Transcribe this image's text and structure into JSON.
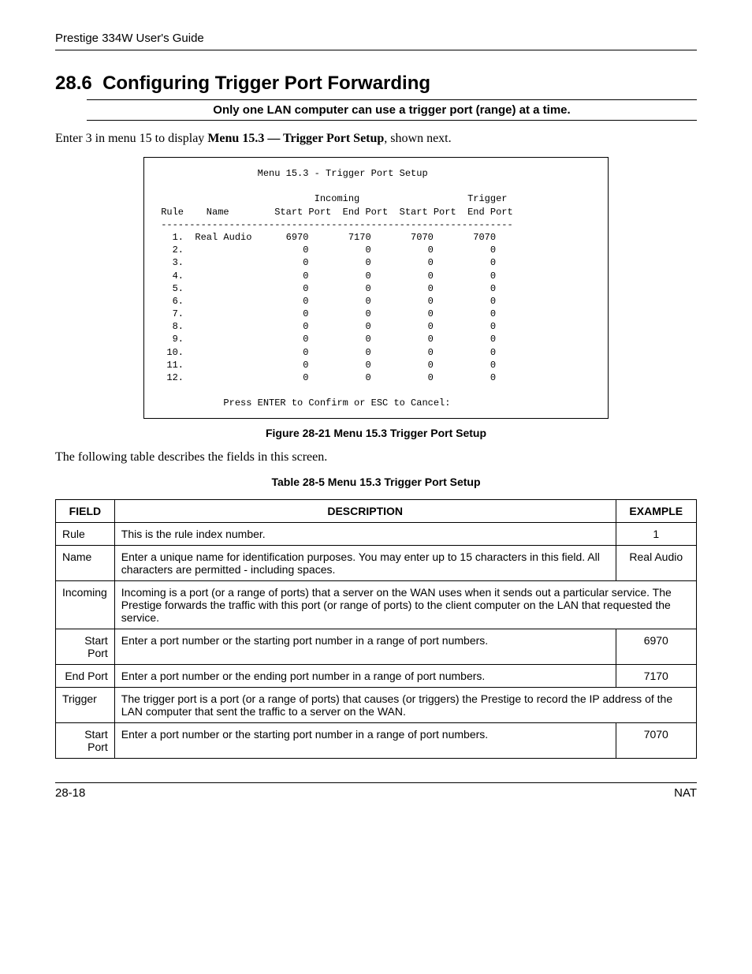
{
  "header": {
    "title": "Prestige 334W User's Guide"
  },
  "section": {
    "number": "28.6",
    "title": "Configuring Trigger Port Forwarding"
  },
  "note": "Only one LAN computer can use a trigger port (range) at a time.",
  "intro_prefix": "Enter 3 in menu 15 to display ",
  "intro_bold": "Menu 15.3 — Trigger Port Setup",
  "intro_suffix": ", shown next.",
  "figure": {
    "title": "Menu 15.3 - Trigger Port Setup",
    "group1": "Incoming",
    "group2": "Trigger",
    "col_rule": "Rule",
    "col_name": "Name",
    "col_start": "Start Port",
    "col_end": "End Port",
    "rows": [
      {
        "n": "1.",
        "name": "Real Audio",
        "is": "6970",
        "ie": "7170",
        "ts": "7070",
        "te": "7070"
      },
      {
        "n": "2.",
        "name": "",
        "is": "0",
        "ie": "0",
        "ts": "0",
        "te": "0"
      },
      {
        "n": "3.",
        "name": "",
        "is": "0",
        "ie": "0",
        "ts": "0",
        "te": "0"
      },
      {
        "n": "4.",
        "name": "",
        "is": "0",
        "ie": "0",
        "ts": "0",
        "te": "0"
      },
      {
        "n": "5.",
        "name": "",
        "is": "0",
        "ie": "0",
        "ts": "0",
        "te": "0"
      },
      {
        "n": "6.",
        "name": "",
        "is": "0",
        "ie": "0",
        "ts": "0",
        "te": "0"
      },
      {
        "n": "7.",
        "name": "",
        "is": "0",
        "ie": "0",
        "ts": "0",
        "te": "0"
      },
      {
        "n": "8.",
        "name": "",
        "is": "0",
        "ie": "0",
        "ts": "0",
        "te": "0"
      },
      {
        "n": "9.",
        "name": "",
        "is": "0",
        "ie": "0",
        "ts": "0",
        "te": "0"
      },
      {
        "n": "10.",
        "name": "",
        "is": "0",
        "ie": "0",
        "ts": "0",
        "te": "0"
      },
      {
        "n": "11.",
        "name": "",
        "is": "0",
        "ie": "0",
        "ts": "0",
        "te": "0"
      },
      {
        "n": "12.",
        "name": "",
        "is": "0",
        "ie": "0",
        "ts": "0",
        "te": "0"
      }
    ],
    "footer": "Press ENTER to Confirm or ESC to Cancel:",
    "caption": "Figure 28-21 Menu 15.3 Trigger Port Setup"
  },
  "table_intro": "The following table describes the fields in this screen.",
  "table": {
    "caption": "Table 28-5 Menu 15.3 Trigger Port Setup",
    "head_field": "FIELD",
    "head_desc": "DESCRIPTION",
    "head_example": "EXAMPLE",
    "rows": [
      {
        "field": "Rule",
        "desc": "This is the rule index number.",
        "ex": "1",
        "sub": false
      },
      {
        "field": "Name",
        "desc": "Enter a unique name for identification purposes. You may enter up to 15 characters in this field. All characters are permitted - including spaces.",
        "ex": "Real Audio",
        "sub": false
      },
      {
        "field": "Incoming",
        "desc": "Incoming is a port (or a range of ports) that a server on the WAN uses when it sends out a particular service. The Prestige forwards the traffic with this port (or range of ports) to the client computer on the LAN that requested the service.",
        "ex": "",
        "sub": false,
        "span": true
      },
      {
        "field": "Start Port",
        "desc": "Enter a port number or the starting port number in a range of port numbers.",
        "ex": "6970",
        "sub": true
      },
      {
        "field": "End Port",
        "desc": "Enter a port number or the ending port number in a range of port numbers.",
        "ex": "7170",
        "sub": true
      },
      {
        "field": "Trigger",
        "desc": "The trigger port is a port (or a range of ports) that causes (or triggers) the Prestige to record the IP address of the LAN computer that sent the traffic to a server on the WAN.",
        "ex": "",
        "sub": false,
        "span": true
      },
      {
        "field": "Start Port",
        "desc": "Enter a port number or the starting port number in a range of port numbers.",
        "ex": "7070",
        "sub": true
      }
    ]
  },
  "footer": {
    "left": "28-18",
    "right": "NAT"
  }
}
